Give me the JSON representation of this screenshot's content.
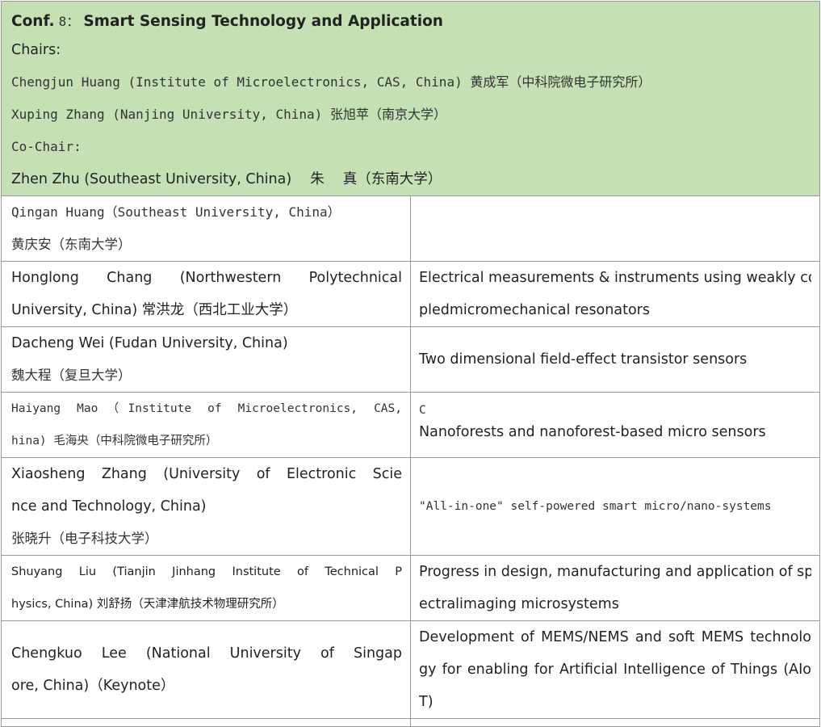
{
  "header": {
    "conf_label": "Conf.",
    "conf_number": "8：",
    "title": "Smart Sensing Technology and Application",
    "chairs_label": "Chairs:",
    "chairs": [
      "Chengjun Huang (Institute of Microelectronics, CAS, China)  黄成军（中科院微电子研究所）",
      "Xuping Zhang (Nanjing University, China)  张旭苹（南京大学）"
    ],
    "cochair_label": "Co-Chair:",
    "cochair": "Zhen Zhu (Southeast University, China)　 朱　 真（东南大学）"
  },
  "rows": [
    {
      "speaker": [
        "Qingan Huang（Southeast University, China）",
        "黄庆安（东南大学）"
      ],
      "talk": []
    },
    {
      "speaker": [
        "Honglong Chang (Northwestern Polytechnical",
        "University, China)  常洪龙（西北工业大学）"
      ],
      "talk": [
        "Electrical measurements & instruments using weakly cou",
        "pledmicromechanical resonators"
      ]
    },
    {
      "speaker": [
        "Dacheng Wei (Fudan University, China)",
        "魏大程（复旦大学）"
      ],
      "talk": [
        "Two dimensional field-effect transistor sensors"
      ]
    },
    {
      "speaker": [
        "Haiyang Mao（Institute of Microelectronics, CAS,",
        "hina)  毛海央（中科院微电子研究所）"
      ],
      "talk": [
        "C",
        "Nanoforests and nanoforest-based micro sensors"
      ]
    },
    {
      "speaker": [
        "Xiaosheng Zhang (University of Electronic Scie",
        "nce and Technology, China)",
        "张晓升（电子科技大学）"
      ],
      "talk": [
        "\"All-in-one\" self-powered smart micro/nano-systems"
      ]
    },
    {
      "speaker": [
        "Shuyang Liu  (Tianjin Jinhang Institute of Technical P",
        "hysics, China)  刘舒扬（天津津航技术物理研究所）"
      ],
      "talk": [
        "Progress in design, manufacturing and application of sp",
        "ectralimaging microsystems"
      ]
    },
    {
      "speaker": [
        "Chengkuo Lee  (National University of Singap",
        "ore, China)（Keynote）"
      ],
      "talk": [
        "Development of MEMS/NEMS and soft MEMS technolo",
        "gy for enabling for Artificial Intelligence of Things (AIo",
        "T)"
      ]
    }
  ]
}
